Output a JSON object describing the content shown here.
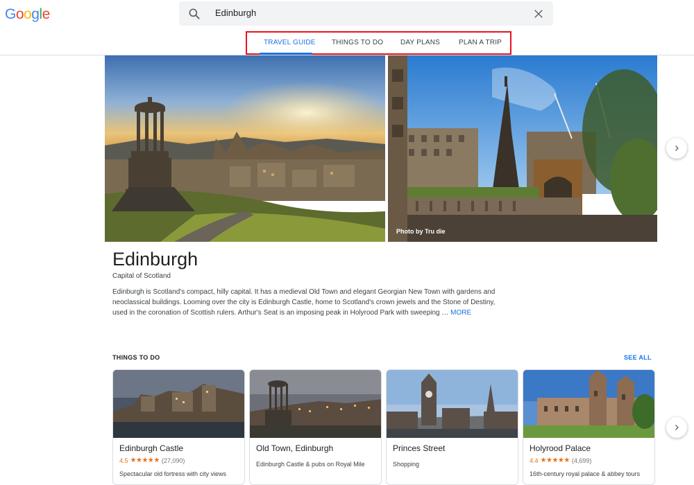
{
  "search": {
    "query": "Edinburgh"
  },
  "tabs": [
    {
      "label": "TRAVEL GUIDE"
    },
    {
      "label": "THINGS TO DO"
    },
    {
      "label": "DAY PLANS"
    },
    {
      "label": "PLAN A TRIP"
    }
  ],
  "hero": {
    "photo_credit": "Photo by Tru die"
  },
  "city": {
    "title": "Edinburgh",
    "subtitle": "Capital of Scotland",
    "description": "Edinburgh is Scotland's compact, hilly capital. It has a medieval Old Town and elegant Georgian New Town with gardens and neoclassical buildings. Looming over the city is Edinburgh Castle, home to Scotland's crown jewels and the Stone of Destiny, used in the coronation of Scottish rulers. Arthur's Seat is an imposing peak in Holyrood Park with sweeping …",
    "more_label": "MORE"
  },
  "things_to_do": {
    "title": "THINGS TO DO",
    "see_all": "SEE ALL",
    "cards": [
      {
        "name": "Edinburgh Castle",
        "rating": "4.5",
        "stars": "★★★★★",
        "reviews": "(27,090)",
        "desc": "Spectacular old fortress with city views"
      },
      {
        "name": "Old Town, Edinburgh",
        "rating": "",
        "stars": "",
        "reviews": "",
        "desc": "Edinburgh Castle & pubs on Royal Mile"
      },
      {
        "name": "Princes Street",
        "rating": "",
        "stars": "",
        "reviews": "",
        "desc": "Shopping"
      },
      {
        "name": "Holyrood Palace",
        "rating": "4.4",
        "stars": "★★★★★",
        "reviews": "(4,699)",
        "desc": "16th-century royal palace & abbey tours"
      }
    ]
  },
  "colors": {
    "accent": "#1a73e8",
    "rating": "#e7711b",
    "highlight_box": "#e8121c"
  },
  "logo": {
    "text": "Google"
  }
}
